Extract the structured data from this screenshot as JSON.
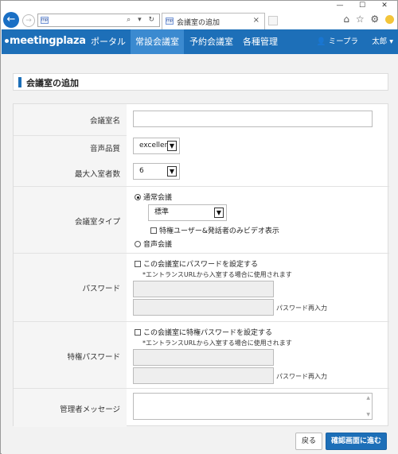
{
  "browser": {
    "address_favicon": "mp",
    "address_tools": "⌕ ▾ ↻",
    "tab_favicon": "mp",
    "tab_title": "会議室の追加",
    "window_controls": {
      "minimize": "—",
      "maximize": "☐",
      "close": "✕"
    },
    "right_tools": {
      "home": "⌂",
      "favorites": "☆",
      "settings": "⚙"
    }
  },
  "app": {
    "logo": "meetingplaza",
    "nav": [
      {
        "label": "ポータル",
        "active": false
      },
      {
        "label": "常設会議室",
        "active": true
      },
      {
        "label": "予約会議室",
        "active": false
      },
      {
        "label": "各種管理",
        "active": false
      }
    ],
    "user_label": "ミープラ",
    "user_name": "太郎"
  },
  "page": {
    "title": "会議室の追加"
  },
  "form": {
    "room_name_label": "会議室名",
    "room_name_value": "",
    "audio_quality_label": "音声品質",
    "audio_quality_value": "excellent",
    "max_participants_label": "最大入室者数",
    "max_participants_value": "6",
    "room_type_label": "会議室タイプ",
    "room_type_normal": "通常会議",
    "room_type_sub_value": "標準",
    "privileged_video_only": "特権ユーザー&発話者のみビデオ表示",
    "room_type_audio": "音声会議",
    "password_label": "パスワード",
    "password_set_check": "この会議室にパスワードを設定する",
    "password_note": "*エントランスURLから入室する場合に使用されます",
    "password_reenter": "パスワード再入力",
    "priv_password_label": "特権パスワード",
    "priv_password_set_check": "この会議室に特権パスワードを設定する",
    "priv_password_note": "*エントランスURLから入室する場合に使用されます",
    "priv_password_reenter": "パスワード再入力",
    "admin_message_label": "管理者メッセージ"
  },
  "buttons": {
    "back": "戻る",
    "confirm": "確認画面に進む"
  }
}
